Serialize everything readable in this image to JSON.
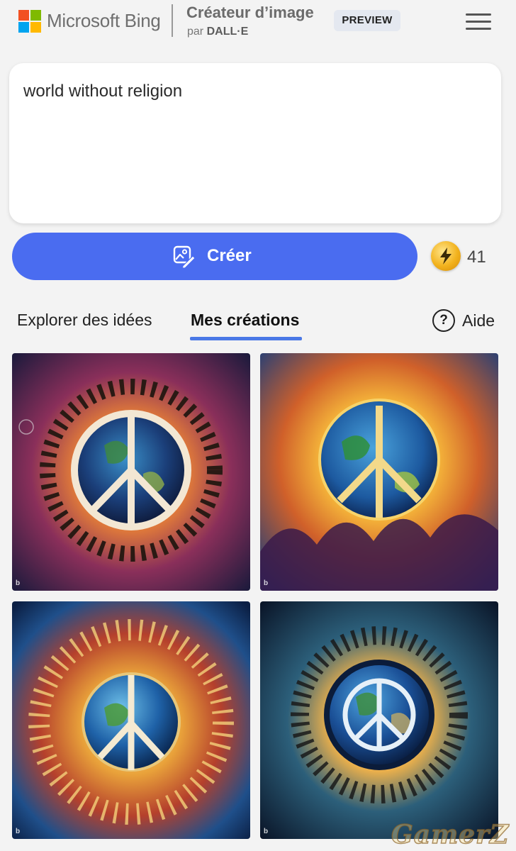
{
  "header": {
    "brand": "Microsoft Bing",
    "app_title": "Créateur d’image",
    "app_sub_prefix": "par",
    "app_sub_model": "DALL·E",
    "badge": "PREVIEW",
    "logo_colors": [
      "#f25022",
      "#7fba00",
      "#00a4ef",
      "#ffb900"
    ]
  },
  "prompt": {
    "value": "world without religion"
  },
  "create": {
    "label": "Créer",
    "boost_count": "41",
    "accent": "#4a6cf0"
  },
  "tabs": [
    {
      "label": "Explorer des idées",
      "active": false
    },
    {
      "label": "Mes créations",
      "active": true
    }
  ],
  "help": {
    "label": "Aide",
    "icon": "question-circle-icon"
  },
  "images": [
    {
      "id": "creation-1",
      "bing_mark": "b"
    },
    {
      "id": "creation-2",
      "bing_mark": "b"
    },
    {
      "id": "creation-3",
      "bing_mark": "b"
    },
    {
      "id": "creation-4",
      "bing_mark": "b"
    }
  ],
  "watermark": "GamerZ"
}
